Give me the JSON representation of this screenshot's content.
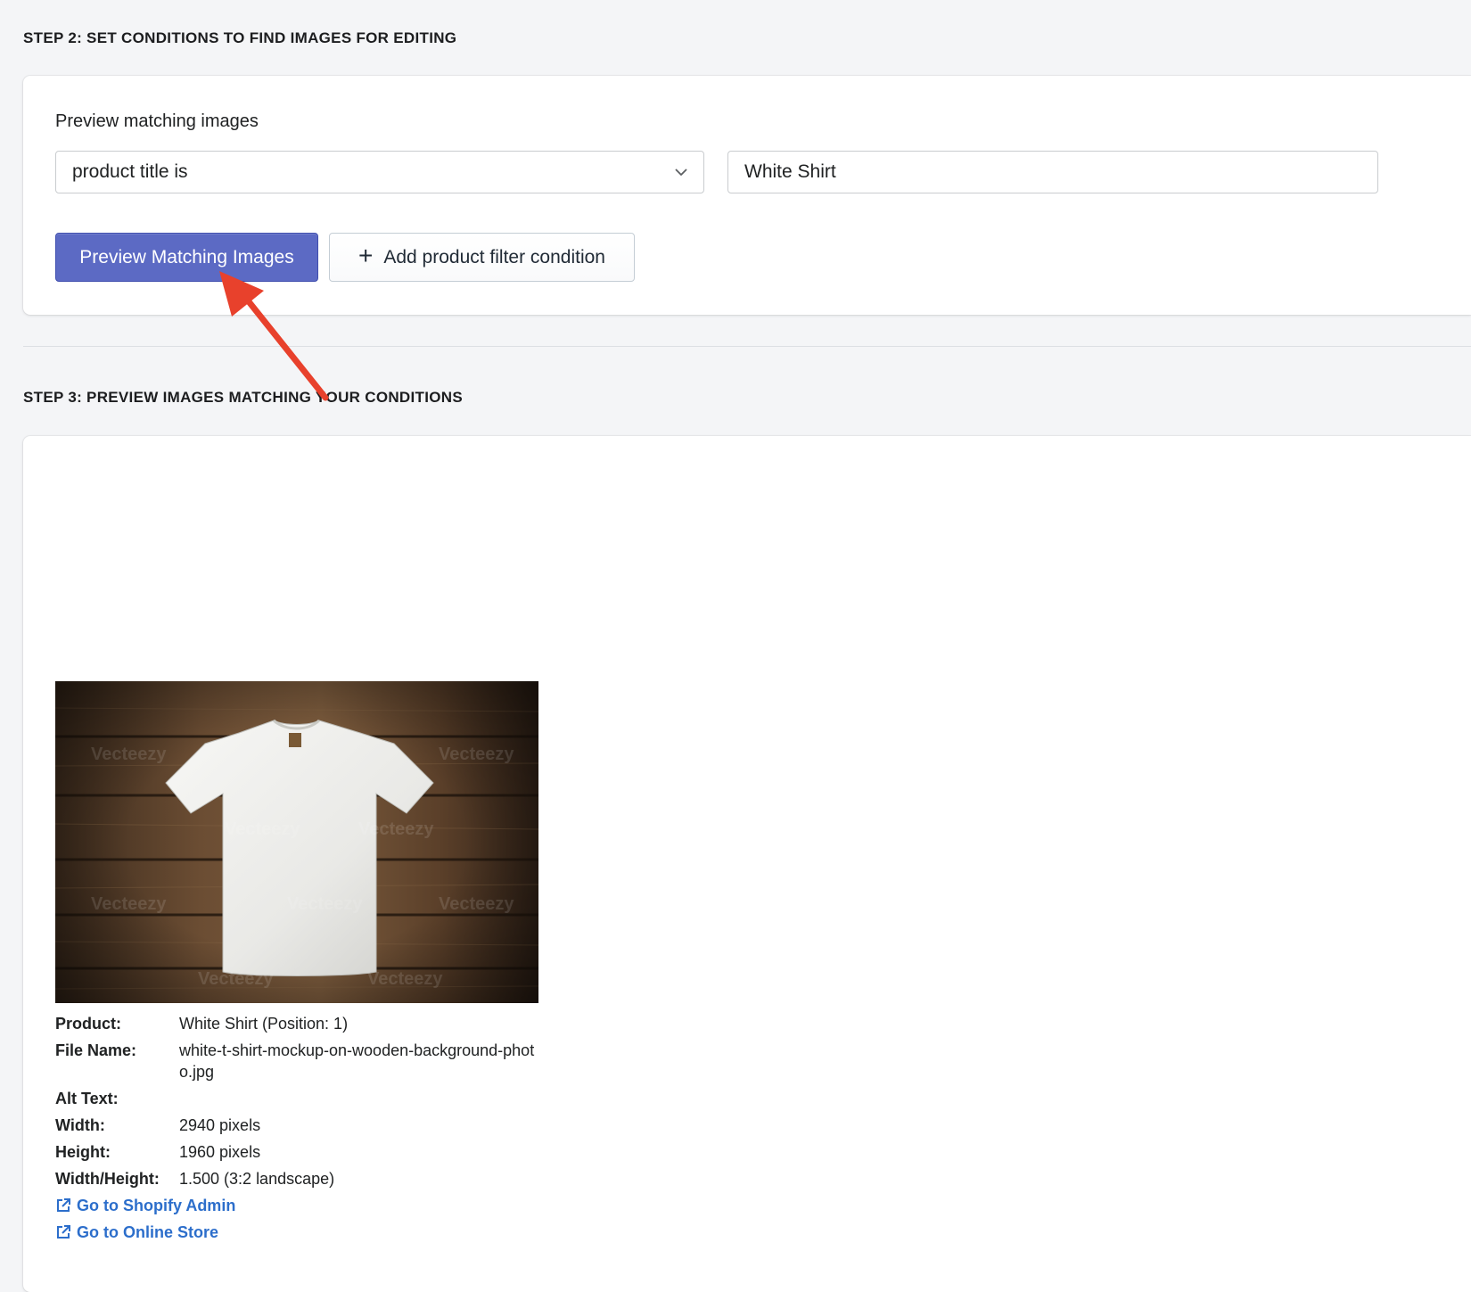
{
  "step2": {
    "heading": "STEP 2: SET CONDITIONS TO FIND IMAGES FOR EDITING",
    "preview_label": "Preview matching images",
    "condition_select": {
      "selected": "product title is",
      "icon": "chevron-down-icon"
    },
    "condition_value": "White Shirt",
    "preview_button_label": "Preview Matching Images",
    "add_condition_button_label": "Add product filter condition",
    "add_condition_icon": "plus-icon"
  },
  "step3": {
    "heading": "STEP 3: PREVIEW IMAGES MATCHING YOUR CONDITIONS",
    "image": {
      "product_label": "Product:",
      "product_value": "White Shirt (Position: 1)",
      "file_name_label": "File Name:",
      "file_name_value": "white-t-shirt-mockup-on-wooden-background-photo.jpg",
      "alt_text_label": "Alt Text:",
      "alt_text_value": "",
      "width_label": "Width:",
      "width_value": "2940 pixels",
      "height_label": "Height:",
      "height_value": "1960 pixels",
      "ratio_label": "Width/Height:",
      "ratio_value": "1.500 (3:2 landscape)",
      "watermark_text": "Vecteezy",
      "links": {
        "shopify_admin": "Go to Shopify Admin",
        "online_store": "Go to Online Store",
        "icon": "external-link-icon"
      }
    }
  },
  "colors": {
    "primary_button": "#5c6ac4",
    "link": "#2c6ecb",
    "annotation_arrow": "#e8412c",
    "background": "#f4f5f7"
  }
}
